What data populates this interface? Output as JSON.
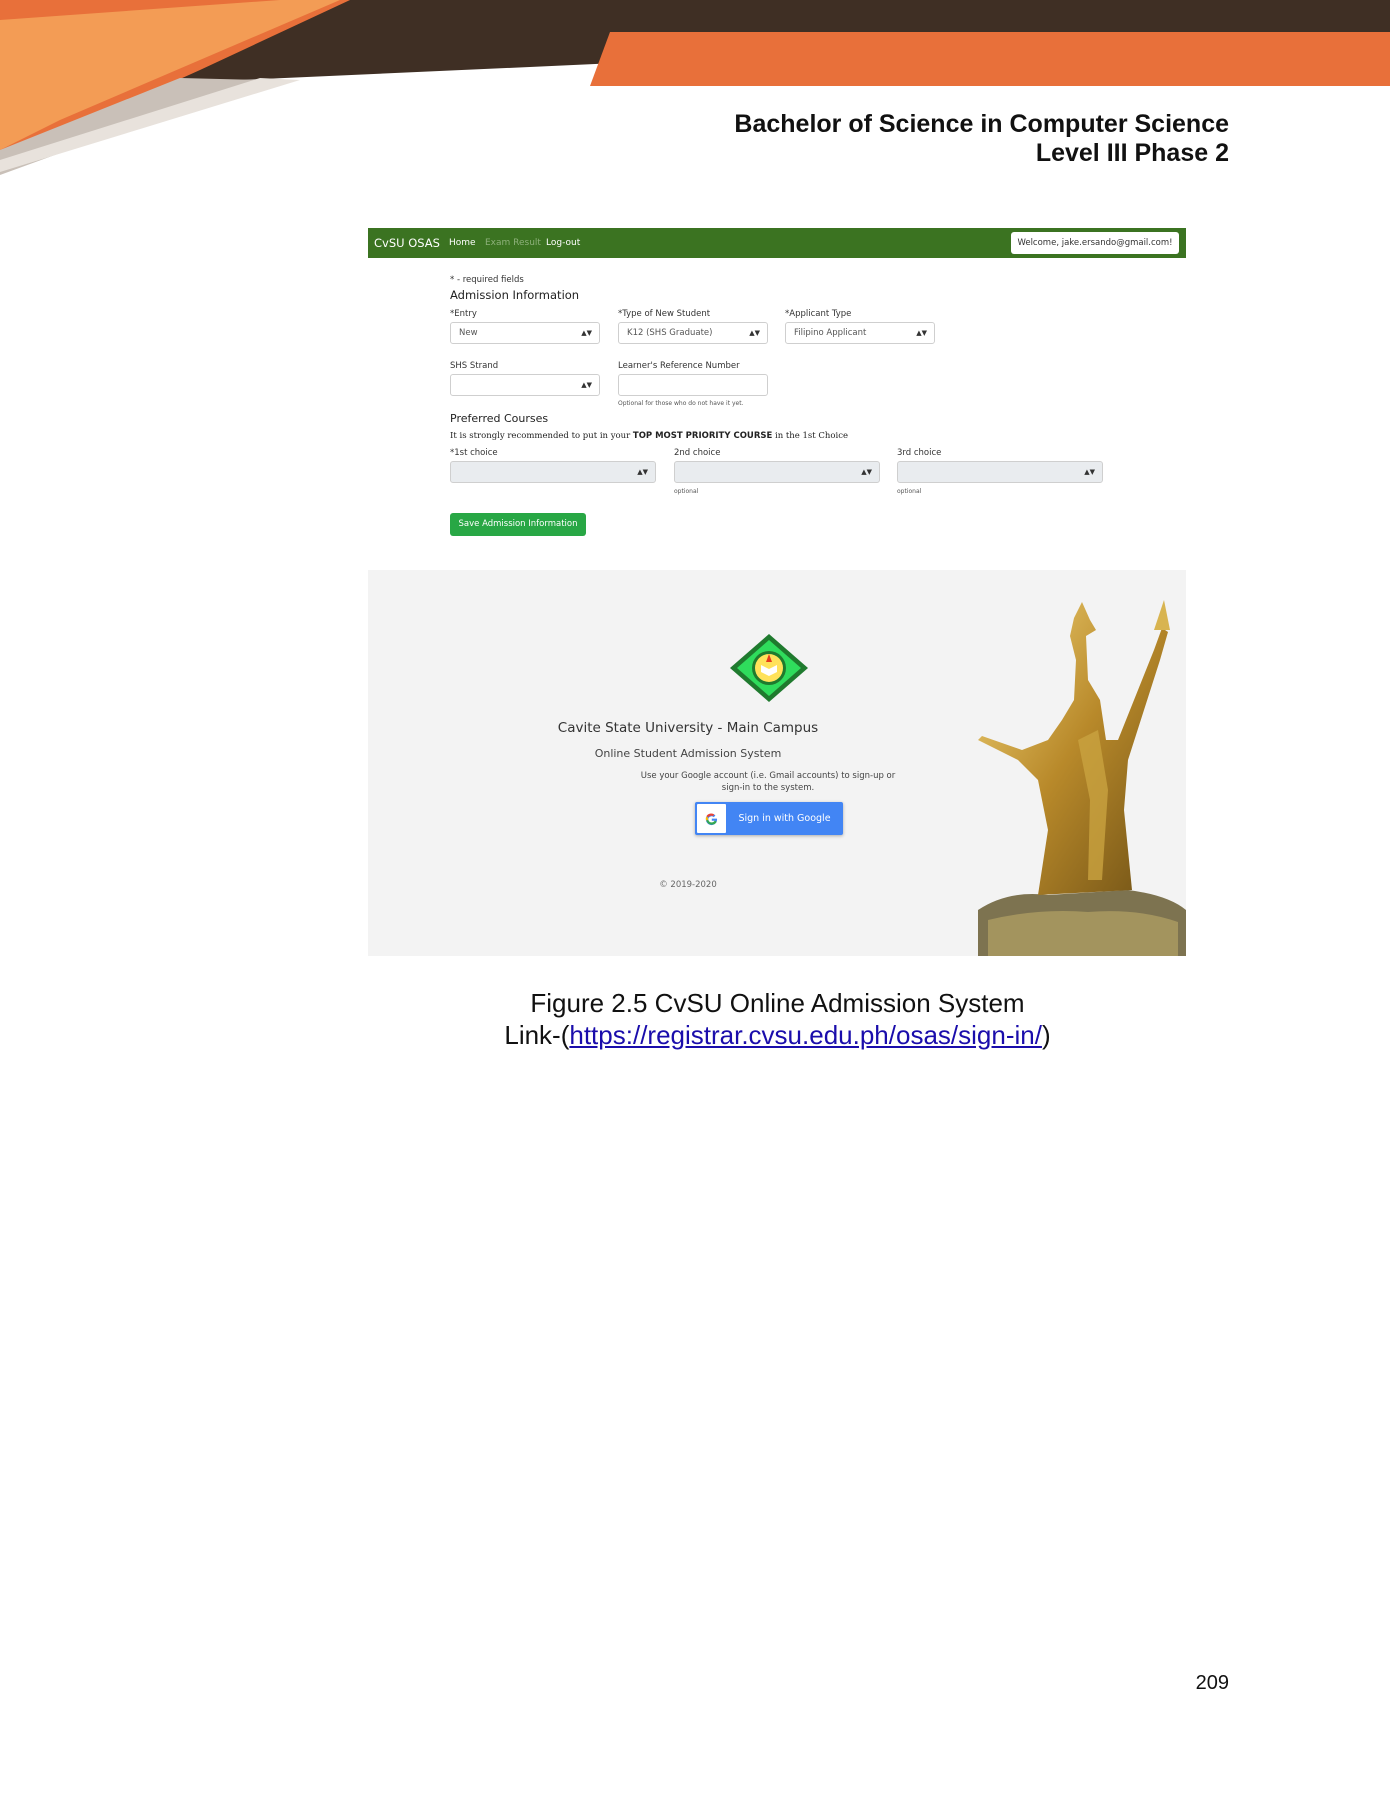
{
  "document": {
    "heading_line1": "Bachelor of Science in Computer Science",
    "heading_line2": "Level III Phase 2",
    "page_number": "209"
  },
  "colors": {
    "orange": "#e8703a",
    "dark_brown": "#3f2f24",
    "nav_green": "#3b7321",
    "save_green": "#28a745",
    "google_blue": "#4285f4",
    "link_blue": "#1a0dab"
  },
  "admission_form": {
    "brand": "CvSU OSAS",
    "nav": [
      "Home",
      "Exam Result",
      "Log-out"
    ],
    "welcome": "Welcome, jake.ersando@gmail.com!",
    "required_note": "* - required fields",
    "section_title": "Admission Information",
    "entry_label": "*Entry",
    "entry_value": "New",
    "type_label": "*Type of New Student",
    "type_value": "K12 (SHS Graduate)",
    "applicant_label": "*Applicant Type",
    "applicant_value": "Filipino Applicant",
    "strand_label": "SHS Strand",
    "lrn_label": "Learner's Reference Number",
    "lrn_help": "Optional for those who do not have it yet.",
    "preferred_title": "Preferred Courses",
    "recommend_pre": "It is strongly recommended to put in your ",
    "recommend_bold": "TOP MOST PRIORITY COURSE",
    "recommend_post": " in the 1st Choice",
    "choice1_label": "*1st choice",
    "choice2_label": "2nd choice",
    "choice3_label": "3rd choice",
    "optional_text": "optional",
    "save_button": "Save Admission Information"
  },
  "signin": {
    "university": "Cavite State University - Main Campus",
    "system": "Online Student Admission System",
    "instruction": "Use your Google account (i.e. Gmail accounts) to sign-up or sign-in to the system.",
    "google_button": "Sign in with Google",
    "copyright": "© 2019-2020"
  },
  "caption": {
    "line1": "Figure 2.5 CvSU Online Admission System",
    "prefix": "Link-(",
    "link": "https://registrar.cvsu.edu.ph/osas/sign-in/",
    "suffix": ")"
  }
}
